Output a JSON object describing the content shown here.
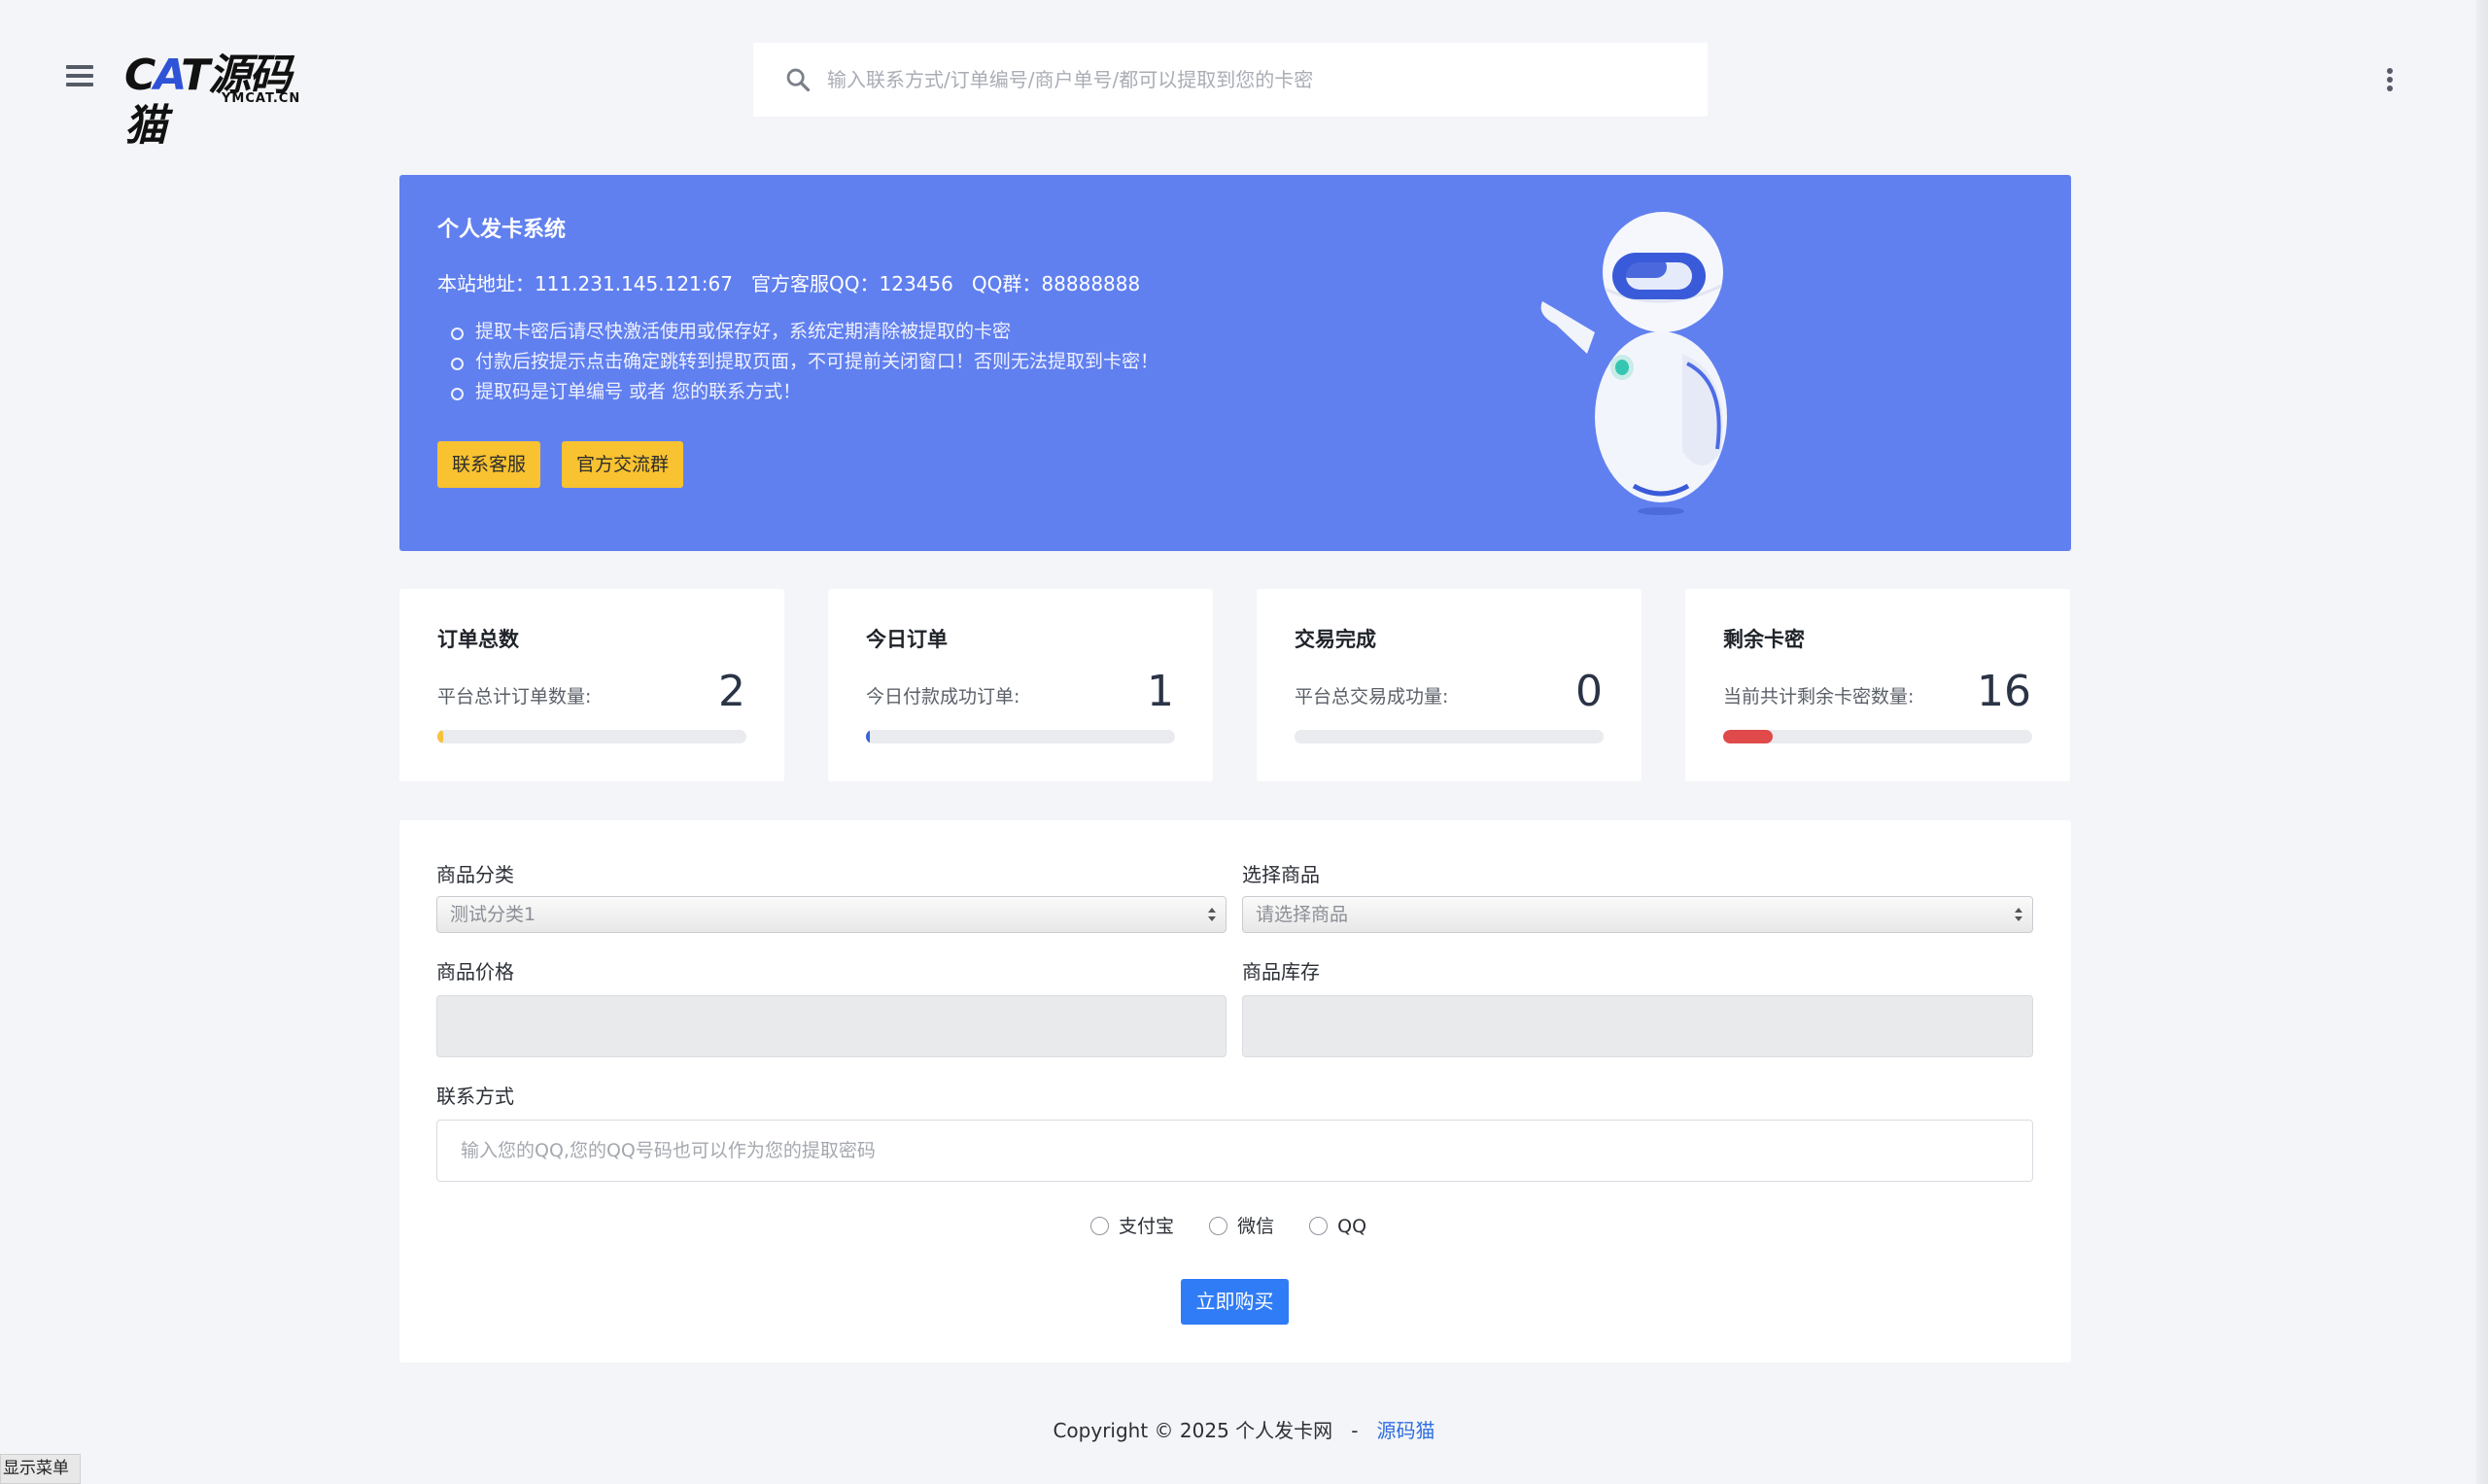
{
  "header": {
    "logo_text": "CAT源码猫",
    "logo_sub": "YMCAT.CN",
    "search_placeholder": "输入联系方式/订单编号/商户单号/都可以提取到您的卡密"
  },
  "banner": {
    "title": "个人发卡系统",
    "info": "本站地址：111.231.145.121:67   官方客服QQ：123456   QQ群：88888888",
    "notices": [
      "提取卡密后请尽快激活使用或保存好，系统定期清除被提取的卡密",
      "付款后按提示点击确定跳转到提取页面，不可提前关闭窗口！否则无法提取到卡密！",
      "提取码是订单编号 或者 您的联系方式！"
    ],
    "btn_contact": "联系客服",
    "btn_group": "官方交流群"
  },
  "stats": [
    {
      "title": "订单总数",
      "label": "平台总计订单数量:",
      "value": "2",
      "progress": 0.02,
      "color": "#f6c23e"
    },
    {
      "title": "今日订单",
      "label": "今日付款成功订单:",
      "value": "1",
      "progress": 0.01,
      "color": "#3b63d9"
    },
    {
      "title": "交易完成",
      "label": "平台总交易成功量:",
      "value": "0",
      "progress": 0,
      "color": "#36b37e"
    },
    {
      "title": "剩余卡密",
      "label": "当前共计剩余卡密数量:",
      "value": "16",
      "progress": 0.16,
      "color": "#e04a4a"
    }
  ],
  "form": {
    "category_label": "商品分类",
    "category_value": "测试分类1",
    "product_label": "选择商品",
    "product_value": "请选择商品",
    "price_label": "商品价格",
    "stock_label": "商品库存",
    "contact_label": "联系方式",
    "contact_placeholder": "输入您的QQ,您的QQ号码也可以作为您的提取密码",
    "pay_options": [
      "支付宝",
      "微信",
      "QQ"
    ],
    "buy_label": "立即购买"
  },
  "footer": {
    "copyright": "Copyright © 2025 个人发卡网   -   ",
    "link": "源码猫"
  },
  "show_menu": "显示菜单"
}
